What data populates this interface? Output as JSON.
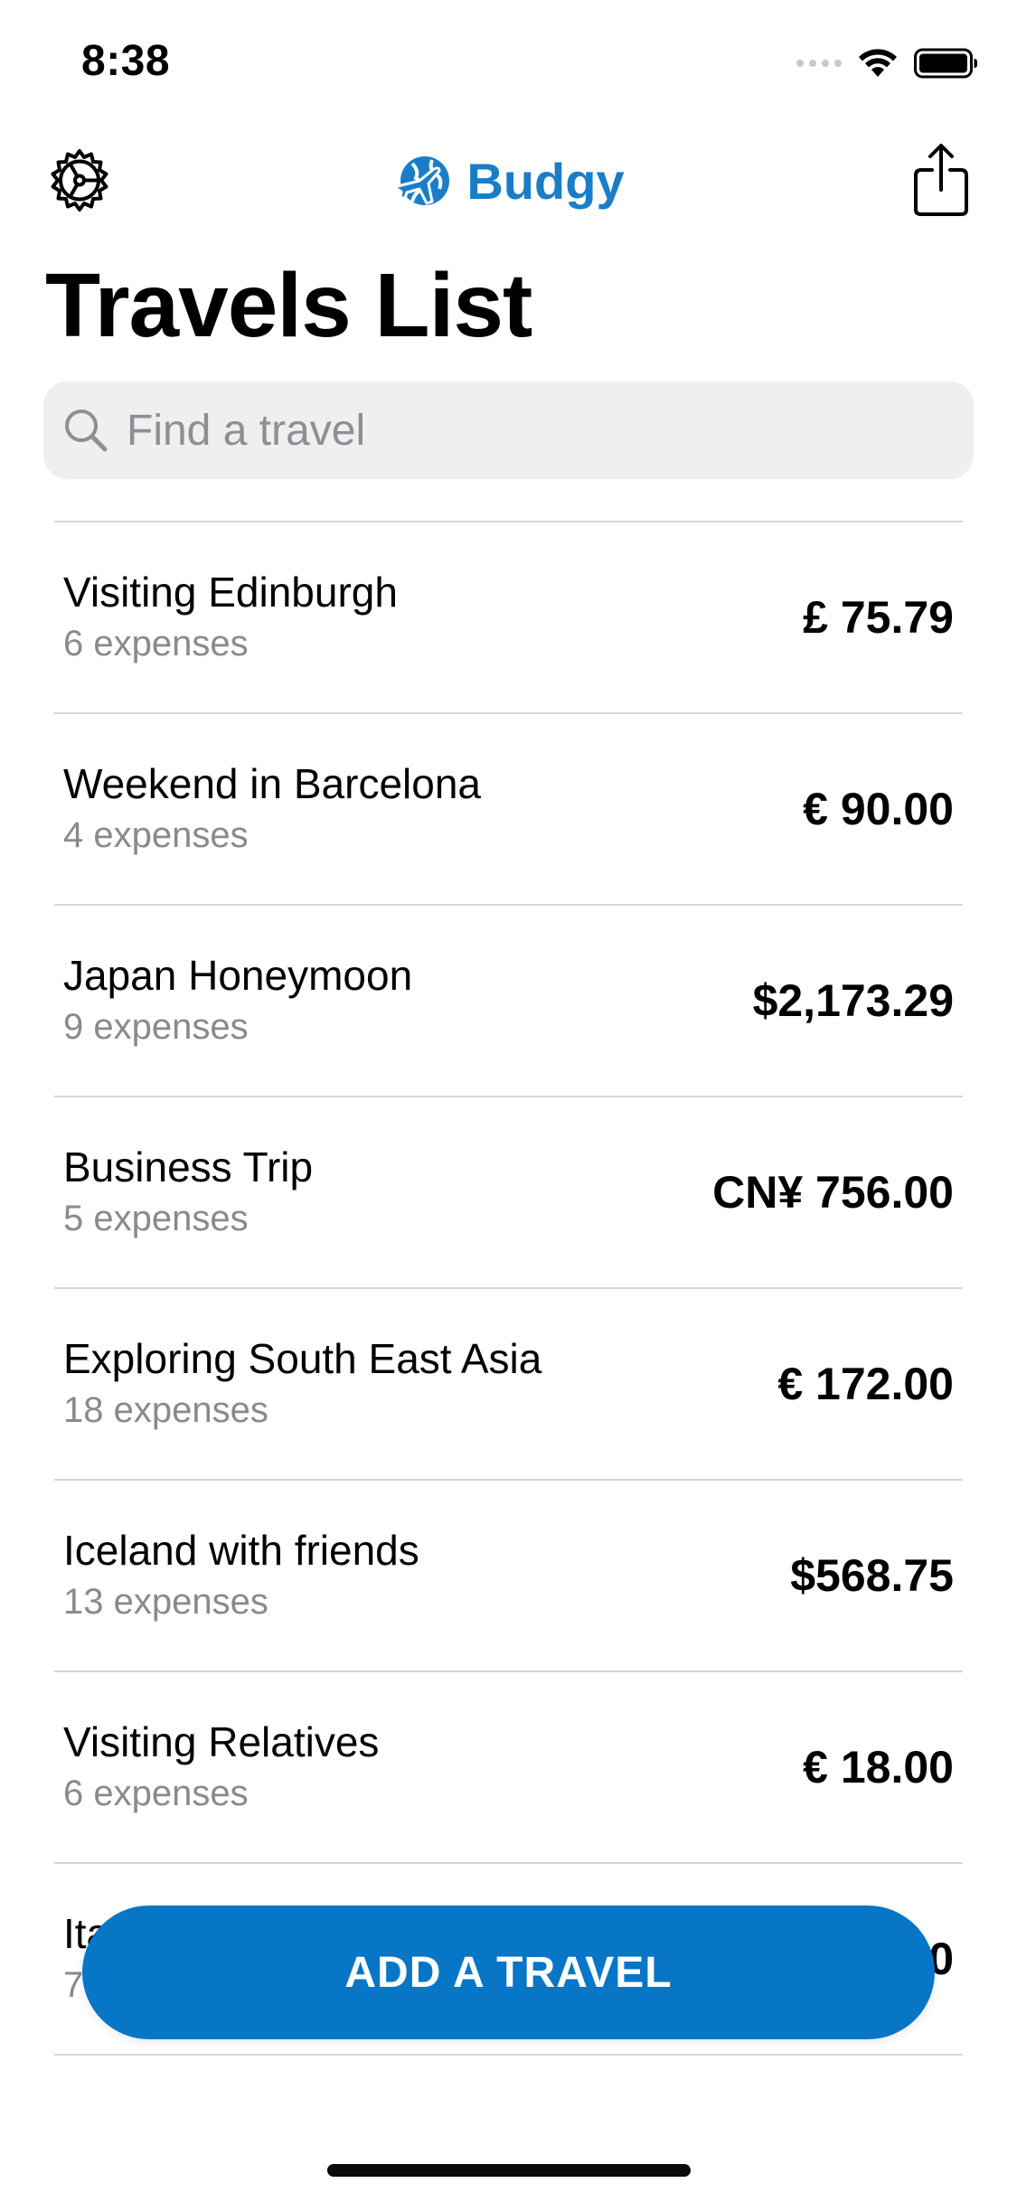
{
  "status_bar": {
    "time": "8:38"
  },
  "nav": {
    "settings_icon": "gear-icon",
    "brand_name": "Budgy",
    "brand_icon": "globe-plane-icon",
    "share_icon": "share-icon"
  },
  "title": "Travels List",
  "search": {
    "placeholder": "Find a travel",
    "value": ""
  },
  "travels": [
    {
      "name": "Visiting Edinburgh",
      "expenses": "6 expenses",
      "amount": "£ 75.79"
    },
    {
      "name": "Weekend in Barcelona",
      "expenses": "4 expenses",
      "amount": "€ 90.00"
    },
    {
      "name": "Japan Honeymoon",
      "expenses": "9 expenses",
      "amount": "$2,173.29"
    },
    {
      "name": "Business Trip",
      "expenses": "5 expenses",
      "amount": "CN¥ 756.00"
    },
    {
      "name": "Exploring South East Asia",
      "expenses": "18 expenses",
      "amount": "€ 172.00"
    },
    {
      "name": "Iceland with friends",
      "expenses": "13 expenses",
      "amount": "$568.75"
    },
    {
      "name": "Visiting Relatives",
      "expenses": "6 expenses",
      "amount": "€ 18.00"
    },
    {
      "name": "Ita",
      "expenses": "7",
      "amount": "0"
    }
  ],
  "add_button": {
    "label": "ADD A TRAVEL"
  },
  "colors": {
    "accent": "#0876c7",
    "brand": "#1a7dc8",
    "secondary_text": "#8a8a8e",
    "divider": "#d6d6d8",
    "search_bg": "#efeff0"
  }
}
